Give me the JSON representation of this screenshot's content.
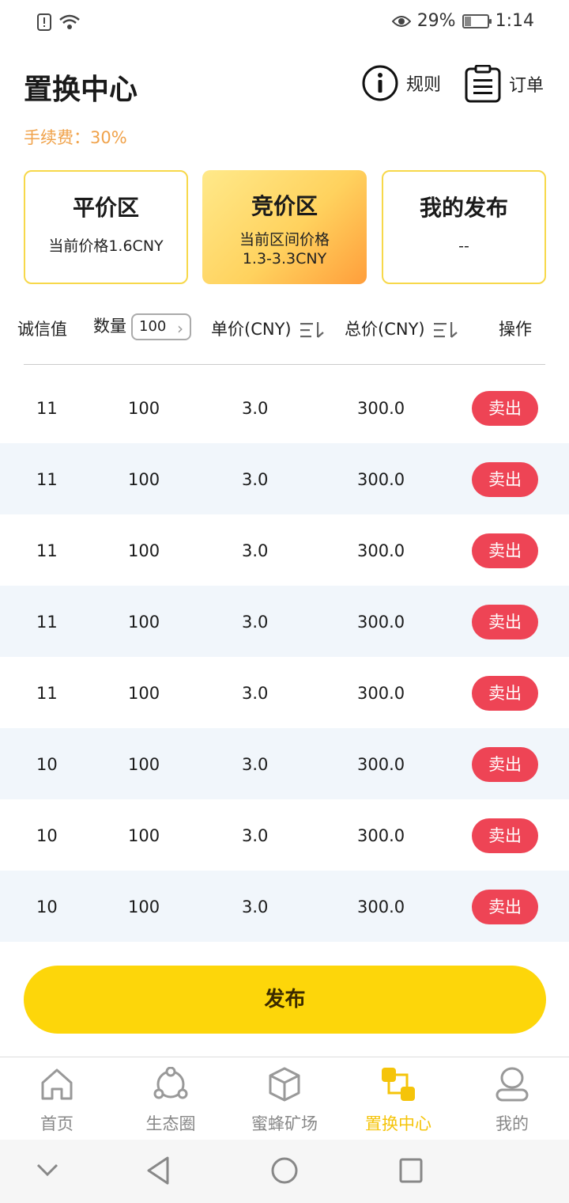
{
  "status_bar": {
    "battery_percent": "29%",
    "time": "1:14",
    "icons": [
      "alert-icon",
      "wifi-icon",
      "eye-icon",
      "battery-icon"
    ]
  },
  "header": {
    "title": "置换中心",
    "rules_label": "规则",
    "orders_label": "订单",
    "fee": "手续费：30%"
  },
  "zones": [
    {
      "title": "平价区",
      "sub1": "当前价格1.6CNY",
      "sub2": ""
    },
    {
      "title": "竞价区",
      "sub1": "当前区间价格",
      "sub2": "1.3-3.3CNY"
    },
    {
      "title": "我的发布",
      "sub1": "--",
      "sub2": ""
    }
  ],
  "table": {
    "headers": {
      "credit": "诚信值",
      "quantity": "数量",
      "quantity_filter": "100",
      "unit_price": "单价(CNY)",
      "total_price": "总价(CNY)",
      "action": "操作"
    },
    "rows": [
      {
        "credit": "11",
        "quantity": "100",
        "unit_price": "3.0",
        "total": "300.0",
        "action": "卖出"
      },
      {
        "credit": "11",
        "quantity": "100",
        "unit_price": "3.0",
        "total": "300.0",
        "action": "卖出"
      },
      {
        "credit": "11",
        "quantity": "100",
        "unit_price": "3.0",
        "total": "300.0",
        "action": "卖出"
      },
      {
        "credit": "11",
        "quantity": "100",
        "unit_price": "3.0",
        "total": "300.0",
        "action": "卖出"
      },
      {
        "credit": "11",
        "quantity": "100",
        "unit_price": "3.0",
        "total": "300.0",
        "action": "卖出"
      },
      {
        "credit": "10",
        "quantity": "100",
        "unit_price": "3.0",
        "total": "300.0",
        "action": "卖出"
      },
      {
        "credit": "10",
        "quantity": "100",
        "unit_price": "3.0",
        "total": "300.0",
        "action": "卖出"
      },
      {
        "credit": "10",
        "quantity": "100",
        "unit_price": "3.0",
        "total": "300.0",
        "action": "卖出"
      }
    ]
  },
  "publish_label": "发布",
  "bottom_nav": [
    {
      "label": "首页",
      "icon": "home-icon"
    },
    {
      "label": "生态圈",
      "icon": "ecosystem-icon"
    },
    {
      "label": "蜜蜂矿场",
      "icon": "box-icon"
    },
    {
      "label": "置换中心",
      "icon": "exchange-icon",
      "active": true
    },
    {
      "label": "我的",
      "icon": "profile-icon"
    }
  ],
  "colors": {
    "accent_yellow": "#fdd60a",
    "sell_red": "#ee4455",
    "fee_orange": "#f0a24a",
    "active_nav": "#f5c40a"
  }
}
